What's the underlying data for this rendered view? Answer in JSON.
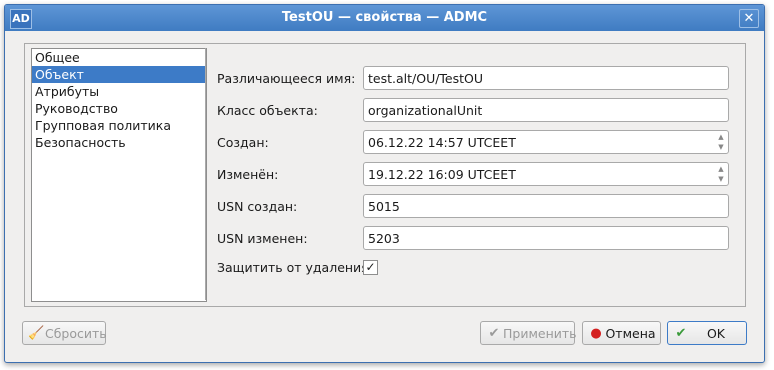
{
  "window": {
    "title": "TestOU — свойства — ADMC",
    "app_icon": "AD",
    "close_glyph": "✕"
  },
  "sidebar": {
    "items": [
      {
        "label": "Общее"
      },
      {
        "label": "Объект"
      },
      {
        "label": "Атрибуты"
      },
      {
        "label": "Руководство"
      },
      {
        "label": "Групповая политика"
      },
      {
        "label": "Безопасность"
      }
    ],
    "selected_index": 1
  },
  "fields": {
    "dn": {
      "label": "Различающееся имя:",
      "value": "test.alt/OU/TestOU"
    },
    "class": {
      "label": "Класс объекта:",
      "value": "organizationalUnit"
    },
    "created": {
      "label": "Создан:",
      "value": "06.12.22 14:57 UTCEET"
    },
    "modified": {
      "label": "Изменён:",
      "value": "19.12.22 16:09 UTCEET"
    },
    "usn_created": {
      "label": "USN создан:",
      "value": "5015"
    },
    "usn_changed": {
      "label": "USN изменен:",
      "value": "5203"
    },
    "protect": {
      "label": "Защитить от удаления:",
      "checked": true
    }
  },
  "buttons": {
    "reset": {
      "label": "Сбросить",
      "icon": "broom-icon",
      "enabled": false
    },
    "apply": {
      "label": "Применить",
      "icon": "check-icon",
      "enabled": false
    },
    "cancel": {
      "label": "Отмена",
      "icon": "stop-icon",
      "enabled": true
    },
    "ok": {
      "label": "OK",
      "icon": "ok-check-icon",
      "enabled": true
    }
  },
  "colors": {
    "titlebar": "#4a86c8",
    "selection": "#3d7bc7",
    "cancel_icon": "#d42020",
    "ok_icon": "#3a9a3a"
  }
}
